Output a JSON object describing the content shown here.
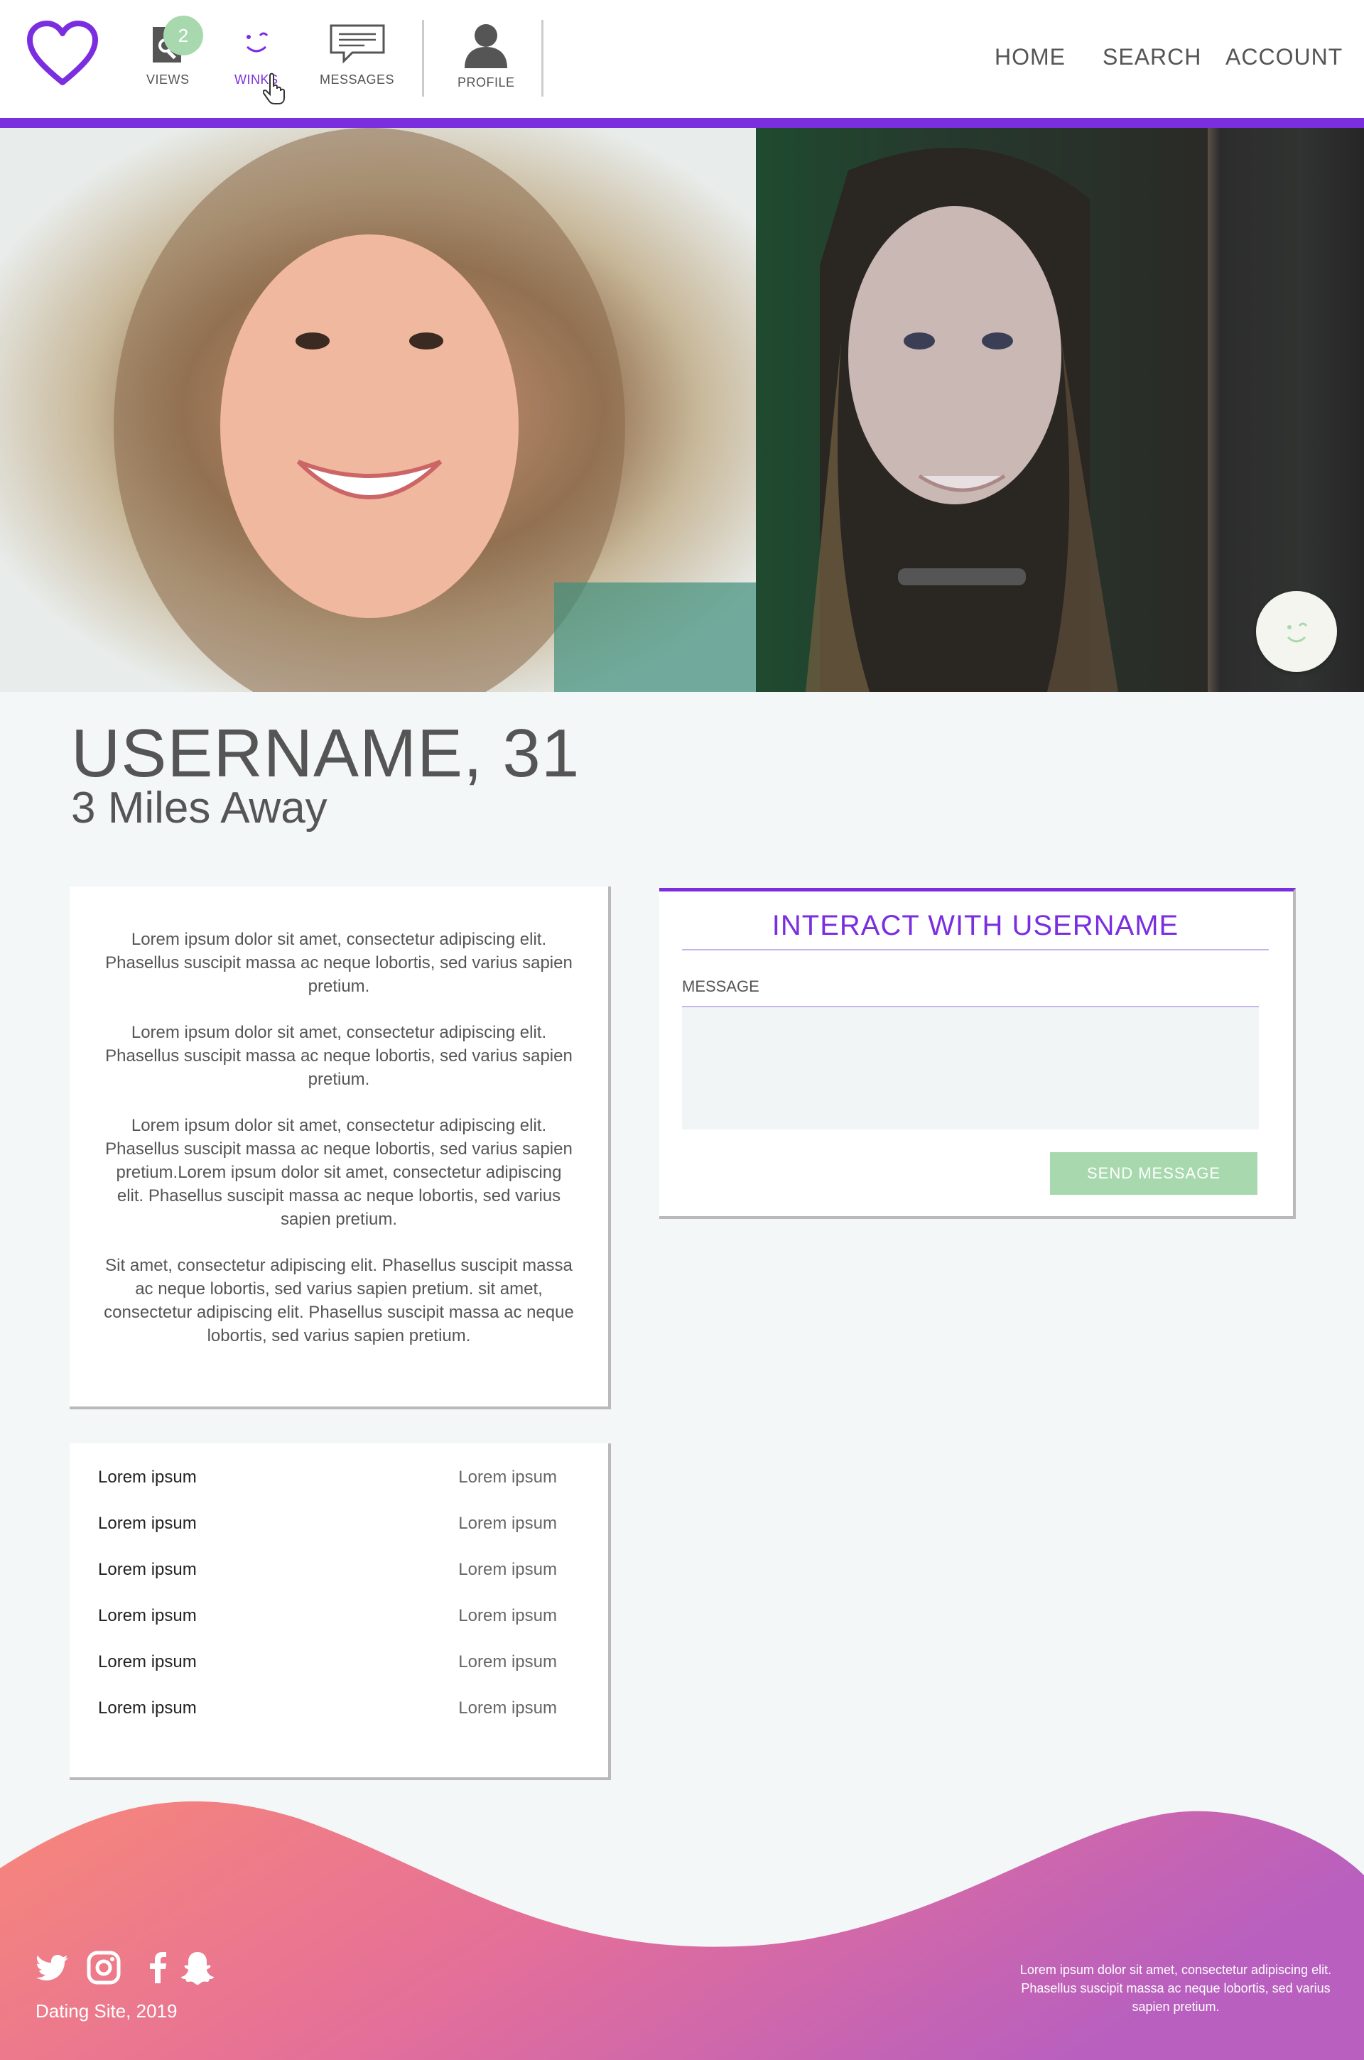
{
  "header": {
    "nav_icons": [
      {
        "label": "VIEWS",
        "icon": "search-icon",
        "badge": "2"
      },
      {
        "label": "WINKS",
        "icon": "wink-icon",
        "active": true
      },
      {
        "label": "MESSAGES",
        "icon": "message-icon"
      },
      {
        "label": "PROFILE",
        "icon": "user-icon"
      }
    ],
    "top_nav": [
      "HOME",
      "SEARCH",
      "ACCOUNT"
    ]
  },
  "profile": {
    "name_age": "USERNAME, 31",
    "distance": "3 Miles Away"
  },
  "about": {
    "paragraphs": [
      "Lorem ipsum dolor sit amet, consectetur adipiscing elit. Phasellus suscipit massa ac neque lobortis, sed varius sapien pretium.",
      "Lorem ipsum dolor sit amet, consectetur adipiscing elit. Phasellus suscipit massa ac neque lobortis, sed varius sapien pretium.",
      "Lorem ipsum dolor sit amet, consectetur adipiscing elit. Phasellus suscipit massa ac neque lobortis, sed varius sapien pretium.Lorem ipsum dolor sit amet, consectetur adipiscing elit. Phasellus suscipit massa ac neque lobortis, sed varius sapien pretium.",
      "Sit amet, consectetur adipiscing elit. Phasellus suscipit massa ac neque lobortis, sed varius sapien pretium. sit amet, consectetur adipiscing elit. Phasellus suscipit massa ac neque lobortis, sed varius sapien pretium."
    ]
  },
  "details": {
    "rows": [
      {
        "key": "Lorem ipsum",
        "value": "Lorem ipsum"
      },
      {
        "key": "Lorem ipsum",
        "value": "Lorem ipsum"
      },
      {
        "key": "Lorem ipsum",
        "value": "Lorem ipsum"
      },
      {
        "key": "Lorem ipsum",
        "value": "Lorem ipsum"
      },
      {
        "key": "Lorem ipsum",
        "value": "Lorem ipsum"
      },
      {
        "key": "Lorem ipsum",
        "value": "Lorem ipsum"
      }
    ]
  },
  "interact": {
    "title": "INTERACT WITH USERNAME",
    "message_label": "MESSAGE",
    "message_value": "",
    "send_label": "SEND MESSAGE"
  },
  "footer": {
    "social_icons": [
      "twitter-icon",
      "instagram-icon",
      "facebook-icon",
      "snapchat-icon"
    ],
    "copyright": "Dating Site, 2019",
    "blurb": "Lorem ipsum dolor sit amet, consectetur adipiscing elit. Phasellus suscipit massa ac neque lobortis, sed varius sapien pretium."
  },
  "colors": {
    "accent": "#7a2ee0",
    "green": "#a8d9ae",
    "background": "#f4f7f7",
    "footer_gradient_start": "#f7877a",
    "footer_gradient_end": "#b85fbf"
  }
}
